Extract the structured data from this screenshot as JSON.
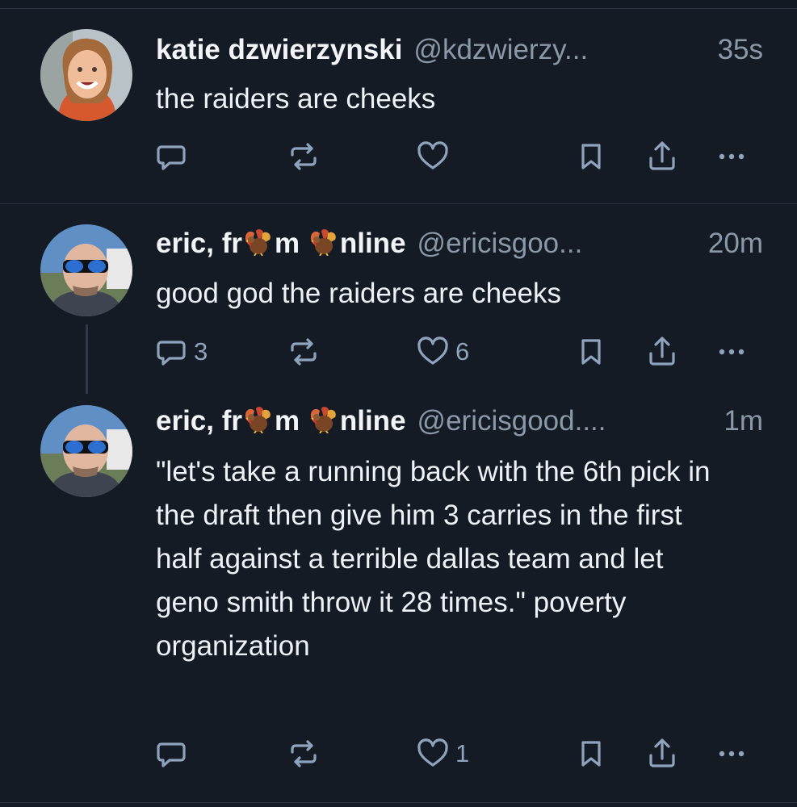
{
  "posts": [
    {
      "name": "katie dzwierzynski",
      "handle": "@kdzwierzy...",
      "time": "35s",
      "text": "the raiders are cheeks",
      "replies": "",
      "likes": ""
    },
    {
      "name_parts": [
        "eric, fr",
        "m ",
        "nline"
      ],
      "handle": "@ericisgoo...",
      "time": "20m",
      "text": "good god the raiders are cheeks",
      "replies": "3",
      "likes": "6"
    },
    {
      "name_parts": [
        "eric, fr",
        "m ",
        "nline"
      ],
      "handle": "@ericisgood....",
      "time": "1m",
      "text": "\"let's take a running back with the 6th pick in the draft then give him 3 carries in the first half against a terrible dallas team and let geno smith throw it 28 times.\" poverty organization",
      "replies": "",
      "likes": "1"
    }
  ],
  "icons": {
    "reply": "reply-icon",
    "repost": "repost-icon",
    "like": "heart-icon",
    "bookmark": "bookmark-icon",
    "share": "share-icon",
    "more": "more-icon",
    "emoji": "turkey-emoji"
  },
  "colors": {
    "background": "#141b25",
    "action": "#8fa3bd",
    "muted_text": "#8b98a8"
  }
}
